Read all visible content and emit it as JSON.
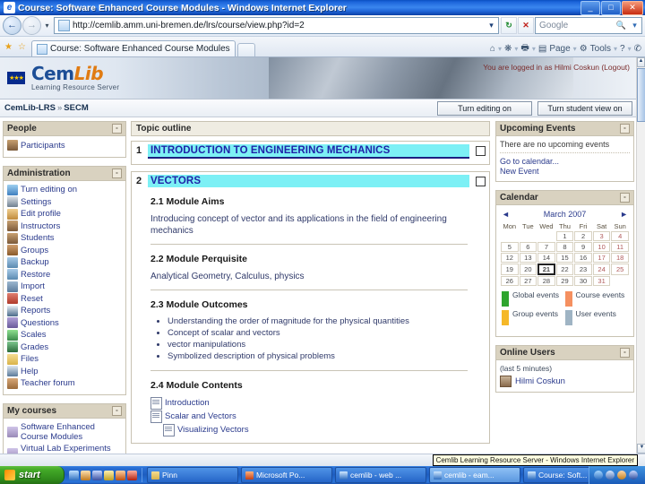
{
  "window": {
    "title": "Course: Software Enhanced Course Modules - Windows Internet Explorer",
    "app_icon": "internet-explorer-icon",
    "minimize": "_",
    "maximize": "□",
    "close": "✕"
  },
  "nav": {
    "back": "←",
    "forward": "→",
    "history_caret": "▾",
    "url": "http://cemlib.amm.uni-bremen.de/lrs/course/view.php?id=2",
    "url_dropdown": "▾",
    "refresh": "↻",
    "stop": "✕",
    "search_placeholder": "Google",
    "search_go": "🔍",
    "search_caret": "▾"
  },
  "tabs": {
    "favorites_icon": "★",
    "add_favorite_icon": "☆",
    "items": [
      {
        "label": "Course: Software Enhanced Course Modules",
        "icon": "page-icon",
        "active": true
      }
    ],
    "new_tab": "",
    "toolbar": [
      {
        "name": "home-icon",
        "glyph": "⌂",
        "label": ""
      },
      {
        "name": "feeds-icon",
        "glyph": "❋",
        "label": ""
      },
      {
        "name": "print-icon",
        "glyph": "🖶",
        "label": ""
      },
      {
        "name": "page-menu",
        "glyph": "▤",
        "label": "Page"
      },
      {
        "name": "tools-menu",
        "glyph": "⚙",
        "label": "Tools"
      },
      {
        "name": "help-icon",
        "glyph": "?",
        "label": ""
      },
      {
        "name": "messenger-icon",
        "glyph": "✆",
        "label": ""
      }
    ]
  },
  "header": {
    "eu_flag": "eu-flag-icon",
    "logo_part1": "Cem",
    "logo_part2": "Lib",
    "logo_subtitle": "Learning Resource Server",
    "login_text": "You are logged in as",
    "login_user": "Hilmi Coskun",
    "logout_label": "(Logout)"
  },
  "breadcrumb": {
    "root": "CemLib-LRS",
    "separator": "»",
    "current": "SECM",
    "editing_button": "Turn editing on",
    "studentview_button": "Turn student view on"
  },
  "sidebar_left": {
    "blocks": [
      {
        "title": "People",
        "collapse": "-",
        "items": [
          {
            "label": "Participants",
            "icon": "people-icon",
            "color": "#7b5a3a"
          }
        ]
      },
      {
        "title": "Administration",
        "collapse": "-",
        "items": [
          {
            "label": "Turn editing on",
            "icon": "pencil-icon",
            "color": "#3f7fbf"
          },
          {
            "label": "Settings",
            "icon": "settings-icon",
            "color": "#6f7f8f"
          },
          {
            "label": "Edit profile",
            "icon": "profile-icon",
            "color": "#c08a3a"
          },
          {
            "label": "Instructors",
            "icon": "people-icon",
            "color": "#7b5a3a"
          },
          {
            "label": "Students",
            "icon": "people-icon",
            "color": "#7b5a3a"
          },
          {
            "label": "Groups",
            "icon": "groups-icon",
            "color": "#8a5a2a"
          },
          {
            "label": "Backup",
            "icon": "backup-icon",
            "color": "#5a8ab0"
          },
          {
            "label": "Restore",
            "icon": "restore-icon",
            "color": "#5a8ab0"
          },
          {
            "label": "Import",
            "icon": "import-icon",
            "color": "#5a7a9a"
          },
          {
            "label": "Reset",
            "icon": "reset-icon",
            "color": "#b03a2a"
          },
          {
            "label": "Reports",
            "icon": "reports-icon",
            "color": "#4a6a8a"
          },
          {
            "label": "Questions",
            "icon": "questions-icon",
            "color": "#6a5a9a"
          },
          {
            "label": "Scales",
            "icon": "scales-icon",
            "color": "#3a8a4a"
          },
          {
            "label": "Grades",
            "icon": "grades-icon",
            "color": "#2a6a3a"
          },
          {
            "label": "Files",
            "icon": "folder-icon",
            "color": "#d9b34a"
          },
          {
            "label": "Help",
            "icon": "help-icon",
            "color": "#5a7a9a"
          },
          {
            "label": "Teacher forum",
            "icon": "forum-icon",
            "color": "#9a6a3a"
          }
        ]
      },
      {
        "title": "My courses",
        "collapse": "-",
        "items": [
          {
            "label": "Software Enhanced Course Modules",
            "icon": "course-icon",
            "color": "#9a8ab8"
          },
          {
            "label": "Virtual Lab Experiments Modules",
            "icon": "course-icon",
            "color": "#9a8ab8"
          }
        ]
      }
    ]
  },
  "main": {
    "outline_header": "Topic outline",
    "topics": [
      {
        "number": "1",
        "title": "INTRODUCTION TO ENGINEERING MECHANICS",
        "underlined": true,
        "sections": []
      },
      {
        "number": "2",
        "title": "VECTORS",
        "underlined": false,
        "sections": [
          {
            "heading": "2.1 Module Aims",
            "text": "Introducing concept of vector and its applications in the field of engineering mechanics",
            "bullets": [],
            "resources": []
          },
          {
            "heading": "2.2 Module Perquisite",
            "text": "Analytical Geometry, Calculus, physics",
            "bullets": [],
            "resources": []
          },
          {
            "heading": "2.3 Module Outcomes",
            "text": "",
            "bullets": [
              "Understanding the order of magnitude for the physical quantities",
              "Concept of scalar and vectors",
              "vector manipulations",
              "Symbolized description of physical problems"
            ],
            "resources": []
          },
          {
            "heading": "2.4 Module Contents",
            "text": "",
            "bullets": [],
            "resources": [
              {
                "label": "Introduction",
                "indent": false
              },
              {
                "label": "Scalar and Vectors",
                "indent": false
              },
              {
                "label": "Visualizing Vectors",
                "indent": true
              }
            ]
          }
        ]
      }
    ]
  },
  "sidebar_right": {
    "upcoming": {
      "title": "Upcoming Events",
      "collapse": "-",
      "empty_text": "There are no upcoming events",
      "links": [
        "Go to calendar...",
        "New Event"
      ]
    },
    "calendar": {
      "title": "Calendar",
      "collapse": "-",
      "prev": "◄",
      "next": "►",
      "month": "March 2007",
      "weekdays": [
        "Mon",
        "Tue",
        "Wed",
        "Thu",
        "Fri",
        "Sat",
        "Sun"
      ],
      "leading_blanks": 3,
      "days": 31,
      "today": 21,
      "legend": [
        {
          "label": "Global events",
          "color": "#2fa52f"
        },
        {
          "label": "Course events",
          "color": "#f59060"
        },
        {
          "label": "Group events",
          "color": "#f5b828"
        },
        {
          "label": "User events",
          "color": "#9fb4c4"
        }
      ]
    },
    "online": {
      "title": "Online Users",
      "collapse": "-",
      "subtitle": "(last 5 minutes)",
      "users": [
        "Hilmi Coskun"
      ]
    }
  },
  "status": {
    "tooltip": "Cemlib Learning Resource Server - Windows Internet Explorer"
  },
  "taskbar": {
    "start_label": "start",
    "quick_launch": [
      "ie-icon",
      "mail-icon",
      "media-icon",
      "notes-icon",
      "acrobat-icon",
      "app-icon"
    ],
    "tasks": [
      {
        "label": "Pinn",
        "icon": "folder-icon",
        "active": false
      },
      {
        "label": "Microsoft Po...",
        "icon": "powerpoint-icon",
        "active": false
      },
      {
        "label": "cemlib - web ...",
        "icon": "ie-icon",
        "active": false
      },
      {
        "label": "cemlib - eam...",
        "icon": "ie-icon",
        "active": true
      },
      {
        "label": "Course: Soft...",
        "icon": "ie-icon",
        "active": false
      }
    ],
    "tray_icons": [
      "network-icon",
      "volume-icon",
      "update-icon",
      "shield-icon"
    ],
    "clock": ""
  }
}
